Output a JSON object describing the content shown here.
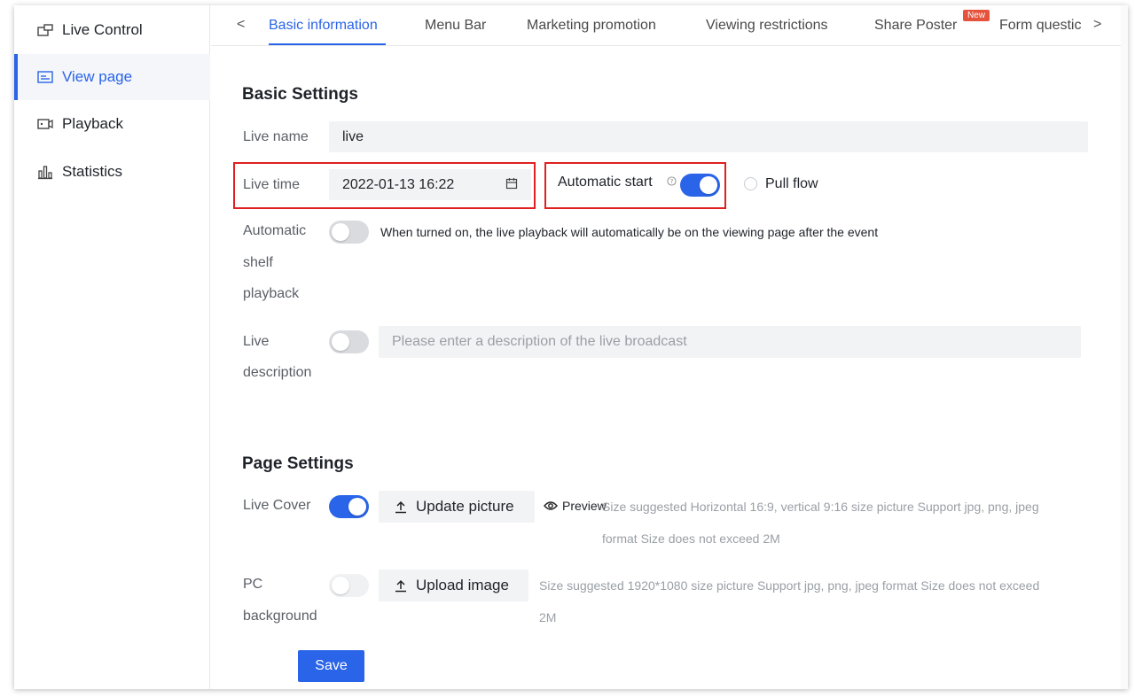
{
  "sidebar": {
    "items": [
      {
        "label": "Live Control",
        "icon": "live-control-icon"
      },
      {
        "label": "View page",
        "icon": "view-page-icon"
      },
      {
        "label": "Playback",
        "icon": "playback-icon"
      },
      {
        "label": "Statistics",
        "icon": "statistics-icon"
      }
    ],
    "active_index": 1
  },
  "tabs": {
    "items": [
      "Basic information",
      "Menu Bar",
      "Marketing promotion",
      "Viewing restrictions",
      "Share Poster",
      "Form questic"
    ],
    "active_index": 0,
    "new_badge": "New",
    "prev_arrow": "<",
    "next_arrow": ">"
  },
  "basic": {
    "title": "Basic Settings",
    "live_name_label": "Live name",
    "live_name_value": "live",
    "live_time_label": "Live time",
    "live_time_value": "2022-01-13 16:22",
    "auto_start_label": "Automatic start",
    "auto_start_on": true,
    "pull_flow_label": "Pull flow",
    "auto_shelf_label_1": "Automatic",
    "auto_shelf_label_2": "shelf",
    "auto_shelf_label_3": "playback",
    "auto_shelf_on": false,
    "auto_shelf_hint": "When turned on, the live playback will automatically be on the viewing page after the event",
    "desc_label_1": "Live",
    "desc_label_2": "description",
    "desc_on": false,
    "desc_placeholder": "Please enter a description of the live broadcast"
  },
  "page": {
    "title": "Page Settings",
    "cover_label": "Live Cover",
    "cover_on": true,
    "update_picture": "Update picture",
    "preview": "Preview",
    "cover_hint_1": "Size suggested Horizontal 16:9, vertical 9:16 size picture  Support jpg, png,  jpeg",
    "cover_hint_2": "format  Size does not exceed 2M",
    "pc_label_1": "PC",
    "pc_label_2": "background",
    "pc_on": false,
    "upload_image": "Upload image",
    "pc_hint_1": "Size suggested 1920*1080 size picture  Support jpg, png,  jpeg format  Size does not exceed",
    "pc_hint_2": "2M"
  },
  "save_label": "Save",
  "colors": {
    "accent": "#2a64e8",
    "highlight_box": "#e02020",
    "badge": "#e5533d"
  }
}
